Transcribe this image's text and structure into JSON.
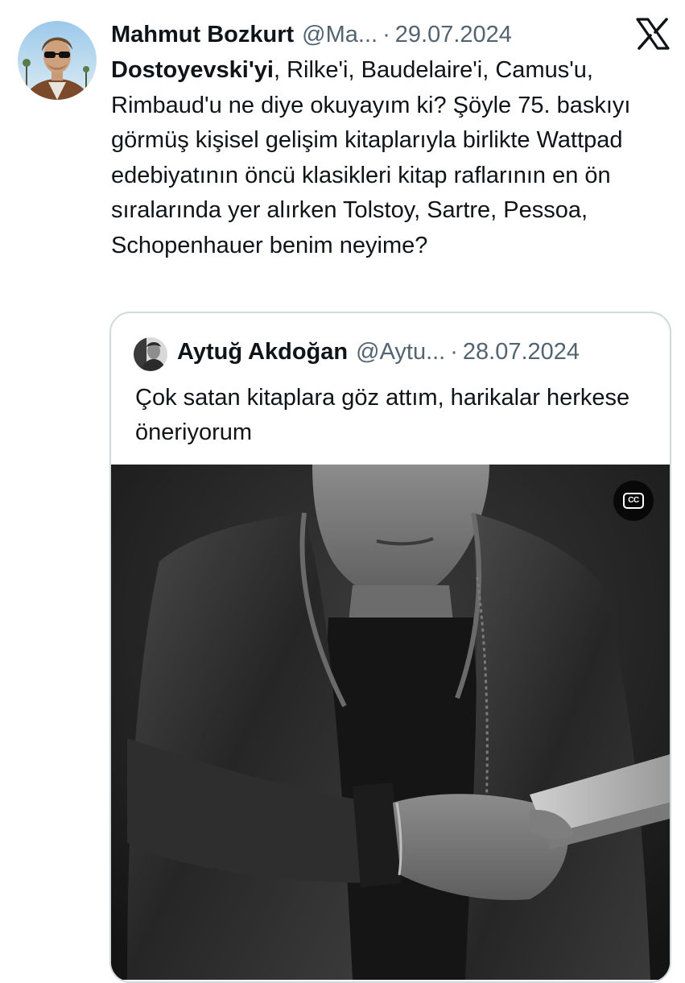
{
  "tweet": {
    "author": {
      "display_name": "Mahmut Bozkurt",
      "handle": "@Ma...",
      "avatar_icon": "person-with-sunglasses-avatar"
    },
    "separator": "·",
    "date": "29.07.2024",
    "platform_icon": "x-logo-icon",
    "text_bold": "Dostoyevski'yi",
    "text_rest": ", Rilke'i, Baudelaire'i, Camus'u, Rimbaud'u ne diye okuyayım ki? Şöyle 75. baskıyı görmüş kişisel gelişim kitaplarıyla birlikte Wattpad edebiyatının öncü klasikleri kitap raflarının en ön sıralarında yer alırken Tolstoy, Sartre, Pessoa, Schopenhauer benim neyime?"
  },
  "quoted_tweet": {
    "author": {
      "display_name": "Aytuğ Akdoğan",
      "handle": "@Aytu...",
      "avatar_icon": "person-avatar"
    },
    "separator": "·",
    "date": "28.07.2024",
    "text": "Çok satan kitaplara göz attım, harikalar herkese öneriyorum",
    "media": {
      "type": "video",
      "description_icon": "man-in-leather-jacket-holding-book",
      "cc_label": "CC"
    }
  },
  "colors": {
    "text_primary": "#0f1419",
    "text_secondary": "#536471",
    "border": "#cfd9de"
  }
}
